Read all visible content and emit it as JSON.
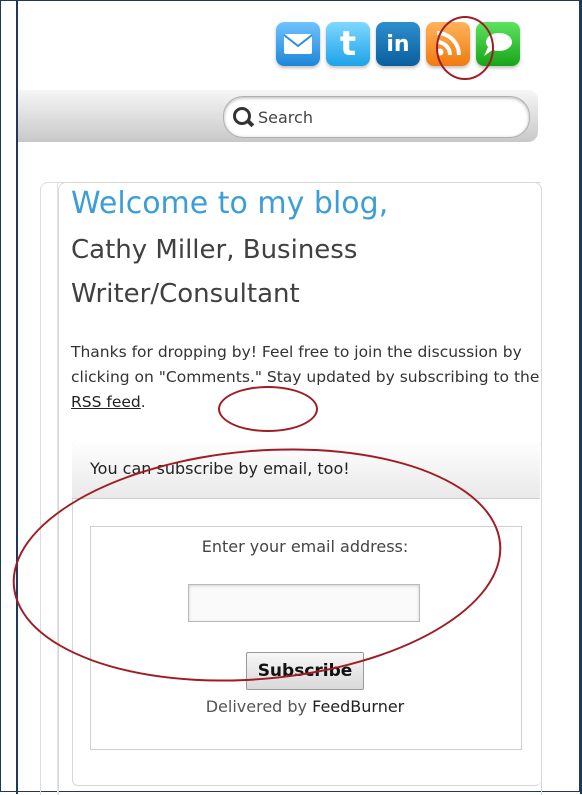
{
  "search": {
    "placeholder": "Search"
  },
  "social": {
    "icons": [
      {
        "name": "email-icon",
        "glyph": "✉"
      },
      {
        "name": "twitter-icon",
        "glyph": "t"
      },
      {
        "name": "linkedin-icon",
        "glyph": "in"
      },
      {
        "name": "rss-icon",
        "glyph": ""
      },
      {
        "name": "chat-icon",
        "glyph": ""
      }
    ]
  },
  "welcome": {
    "title": "Welcome to my blog,",
    "name_line1": "Cathy Miller, Business",
    "name_line2": "Writer/Consultant"
  },
  "intro": {
    "text_before": "Thanks for dropping by! Feel free to join the discussion by clicking on \"Comments.\" Stay updated by subscribing to the ",
    "link_text": "RSS feed",
    "text_after": "."
  },
  "subscribe": {
    "title": "You can subscribe by email, too!",
    "email_label": "Enter your email address:",
    "button_label": "Subscribe",
    "delivered_prefix": "Delivered by ",
    "delivered_brand": "FeedBurner"
  },
  "colors": {
    "accent_blue": "#3d9ed6",
    "annotation_red": "#a01c24",
    "frame": "#1e3a5a"
  }
}
